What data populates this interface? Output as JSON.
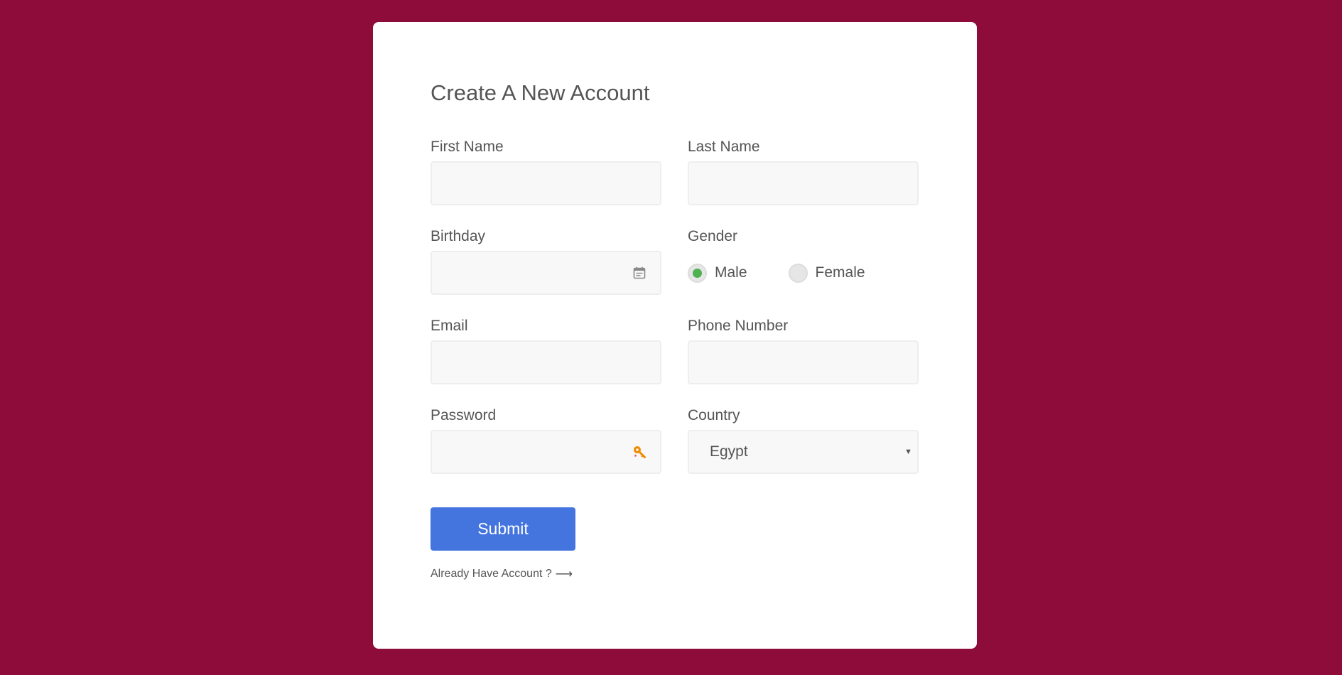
{
  "form": {
    "title": "Create A New Account",
    "first_name": {
      "label": "First Name",
      "value": ""
    },
    "last_name": {
      "label": "Last Name",
      "value": ""
    },
    "birthday": {
      "label": "Birthday",
      "value": "",
      "icon": "calendar-icon"
    },
    "gender": {
      "label": "Gender",
      "options": [
        {
          "label": "Male",
          "checked": true
        },
        {
          "label": "Female",
          "checked": false
        }
      ]
    },
    "email": {
      "label": "Email",
      "value": ""
    },
    "phone": {
      "label": "Phone Number",
      "value": ""
    },
    "password": {
      "label": "Password",
      "value": "",
      "icon": "key-icon"
    },
    "country": {
      "label": "Country",
      "selected": "Egypt"
    },
    "submit_label": "Submit",
    "login_link": {
      "text": "Already Have Account ?",
      "arrow": "⟶"
    }
  },
  "colors": {
    "background": "#8e0c3a",
    "card": "#ffffff",
    "primary_button": "#4474de",
    "radio_checked": "#4fb14f",
    "input_bg": "#f8f8f8",
    "text": "#555555"
  }
}
